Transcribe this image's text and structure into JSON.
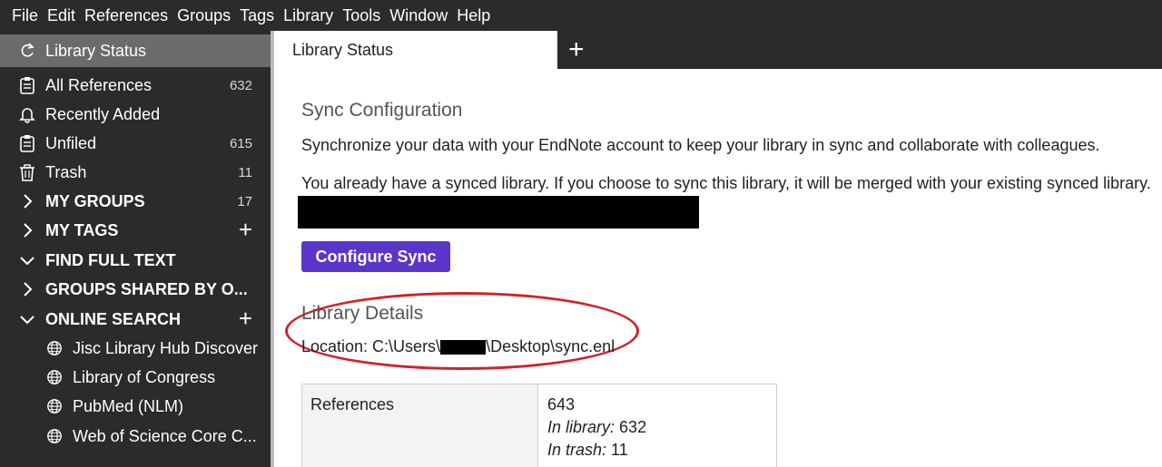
{
  "menu": [
    "File",
    "Edit",
    "References",
    "Groups",
    "Tags",
    "Library",
    "Tools",
    "Window",
    "Help"
  ],
  "sidebar": {
    "status": {
      "label": "Library Status",
      "icon": "sync-icon"
    },
    "items": [
      {
        "label": "All References",
        "count": "632",
        "icon": "clipboard-icon"
      },
      {
        "label": "Recently Added",
        "count": "",
        "icon": "bell-icon"
      },
      {
        "label": "Unfiled",
        "count": "615",
        "icon": "clipboard-icon"
      },
      {
        "label": "Trash",
        "count": "11",
        "icon": "trash-icon"
      }
    ],
    "groups": [
      {
        "label": "MY GROUPS",
        "count": "17",
        "expanded": false
      },
      {
        "label": "MY TAGS",
        "plus": "+",
        "expanded": false
      },
      {
        "label": "FIND FULL TEXT",
        "expanded": true
      },
      {
        "label": "GROUPS SHARED BY O...",
        "expanded": false
      },
      {
        "label": "ONLINE SEARCH",
        "plus": "+",
        "expanded": true
      }
    ],
    "online": [
      {
        "label": "Jisc Library Hub Discover",
        "icon": "globe-icon"
      },
      {
        "label": "Library of Congress",
        "icon": "globe-icon"
      },
      {
        "label": "PubMed (NLM)",
        "icon": "globe-icon"
      },
      {
        "label": "Web of Science Core C...",
        "icon": "globe-icon"
      }
    ]
  },
  "tabs": {
    "active": "Library Status",
    "add": "+"
  },
  "sync": {
    "heading": "Sync Configuration",
    "desc1": "Synchronize your data with your EndNote account to keep your library in sync and collaborate with colleagues.",
    "desc2": "You already have a synced library. If you choose to sync this library, it will be merged with your existing synced library.",
    "button": "Configure Sync"
  },
  "details": {
    "heading": "Library Details",
    "location_prefix": "Location: C:\\Users\\",
    "location_suffix": "\\Desktop\\sync.enl"
  },
  "table": {
    "label": "References",
    "total": "643",
    "in_library_label": "In library:",
    "in_library_value": "632",
    "in_trash_label": "In trash:",
    "in_trash_value": "11"
  },
  "colors": {
    "accent": "#5b34c9",
    "highlight": "#d0222a",
    "sidebar_bg": "#2b2b2b"
  }
}
